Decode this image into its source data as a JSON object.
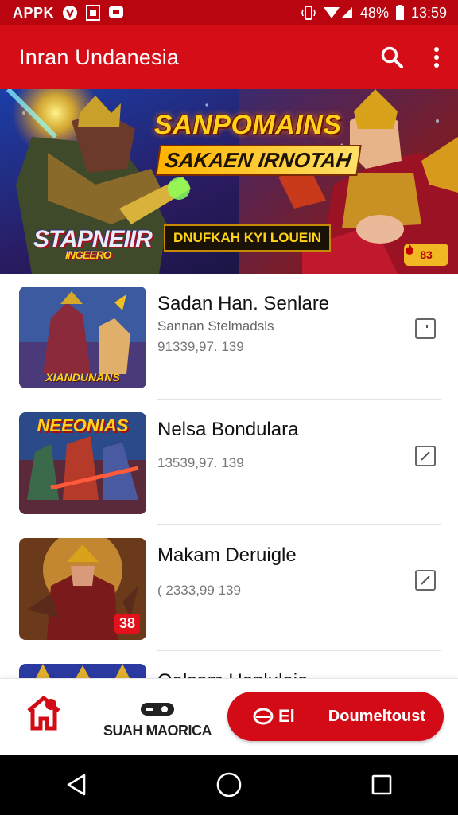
{
  "status_bar": {
    "carrier": "APPK",
    "battery": "48%",
    "time": "13:59",
    "icons": [
      "vpn-icon",
      "sim-icon",
      "message-icon",
      "vibrate-icon",
      "signal-icon",
      "battery-icon"
    ]
  },
  "app_bar": {
    "title": "Inran Undanesia",
    "actions": [
      "search-icon",
      "more-vert-icon"
    ],
    "color": "#d50d17"
  },
  "banner": {
    "headline": "SANPOMAINS",
    "subheadline": "SAKAEN IRNOTAH",
    "logo_text": "STAPNEIIR",
    "logo_sub": "INGEERO",
    "cta_text": "DNUFKAH KYI LOUEIN",
    "badge_text": "83"
  },
  "games": [
    {
      "title": "Sadan Han. Senlare",
      "subtitle": "Sannan Stelmadsls",
      "meta": "91339,97. 139",
      "thumb_text": "XIANDUNANS",
      "badge": "",
      "action_icon": "download-icon"
    },
    {
      "title": "Nelsa Bondulara",
      "subtitle": "",
      "meta": "13539,97. 139",
      "thumb_text": "NEEONIAS",
      "badge": "",
      "action_icon": "edit-icon"
    },
    {
      "title": "Makam Deruigle",
      "subtitle": "",
      "meta": "( 2333,99 139",
      "thumb_text": "",
      "badge": "38",
      "action_icon": "edit-icon"
    },
    {
      "title": "Oalsam Uonlulaia",
      "subtitle": "",
      "meta": "",
      "thumb_text": "",
      "badge": "",
      "action_icon": "edit-icon"
    }
  ],
  "bottom_bar": {
    "home_icon": "home-icon",
    "brand_label": "SUAH MAORICA",
    "cta_prefix": "El",
    "cta_label": "Doumeltoust",
    "accent": "#d20b16"
  },
  "nav_bar": {
    "buttons": [
      "back-icon",
      "home-circle-icon",
      "recents-icon"
    ]
  }
}
